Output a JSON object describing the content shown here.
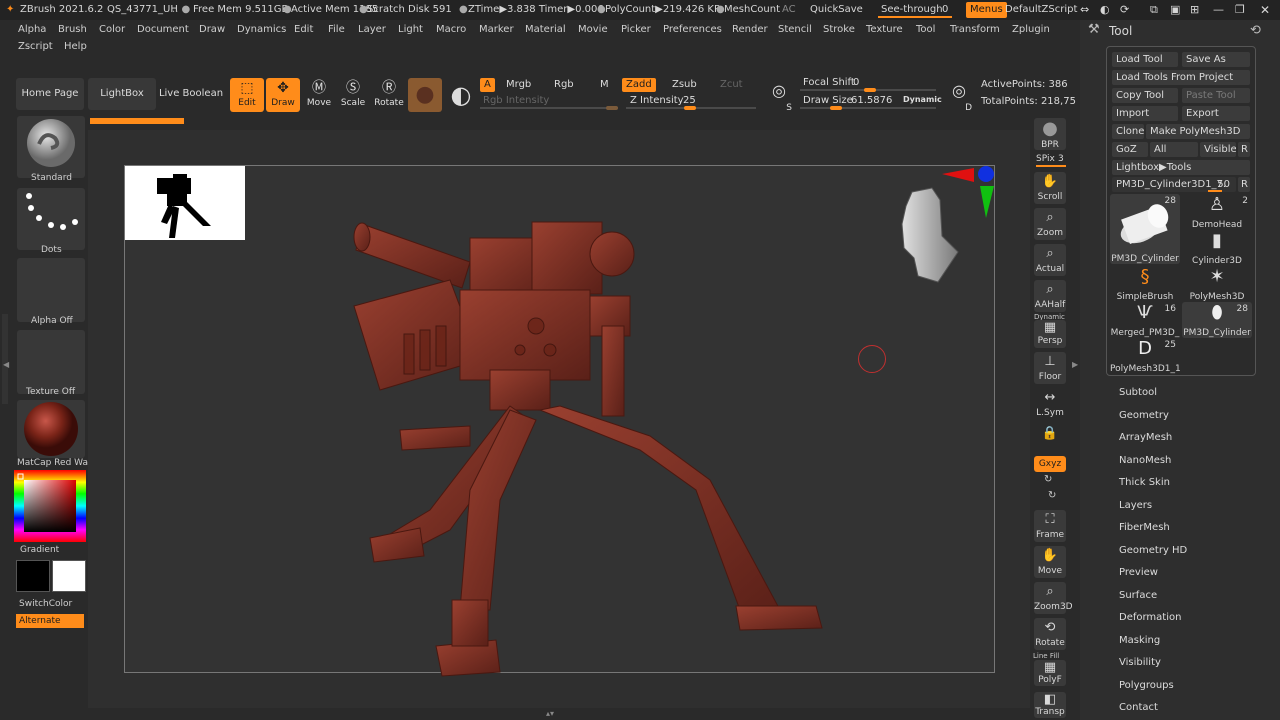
{
  "titlebar": {
    "app": "ZBrush 2021.6.2",
    "doc": "QS_43771_UH",
    "free_mem": "Free Mem 9.511GB",
    "active_mem": "Active Mem 1185",
    "scratch": "Scratch Disk 591",
    "ztime": "ZTime▶3.838 Timer▶0.006",
    "polycount": "PolyCount▶219.426 KP",
    "meshcount": "MeshCount",
    "ac": "AC",
    "quicksave": "QuickSave",
    "seethrough_label": "See-through",
    "seethrough_value": "0",
    "menus": "Menus",
    "zscript": "DefaultZScript"
  },
  "menu": {
    "row1": [
      "Alpha",
      "Brush",
      "Color",
      "Document",
      "Draw",
      "Dynamics",
      "Edit",
      "File",
      "Layer",
      "Light",
      "Macro",
      "Marker",
      "Material",
      "Movie",
      "Picker",
      "Preferences",
      "Render",
      "Stencil",
      "Stroke",
      "Texture",
      "Tool",
      "Transform",
      "Zplugin"
    ],
    "row2": [
      "Zscript",
      "Help"
    ]
  },
  "shelf": {
    "home": "Home Page",
    "lightbox": "LightBox",
    "live_boolean": "Live Boolean",
    "edit": "Edit",
    "draw": "Draw",
    "move": "Move",
    "scale": "Scale",
    "rotate": "Rotate",
    "a": "A",
    "mrgb": "Mrgb",
    "rgb": "Rgb",
    "m": "M",
    "zadd": "Zadd",
    "zsub": "Zsub",
    "zcut": "Zcut",
    "rgb_intensity": "Rgb Intensity",
    "z_intensity_label": "Z Intensity",
    "z_intensity_value": "25",
    "focal_label": "Focal Shift",
    "focal_value": "0",
    "drawsize_label": "Draw Size",
    "drawsize_value": "61.5876",
    "dynamic": "Dynamic",
    "active_points": "ActivePoints: 386",
    "total_points": "TotalPoints: 218,75"
  },
  "left": {
    "standard": "Standard",
    "dots": "Dots",
    "alpha_off": "Alpha Off",
    "texture_off": "Texture Off",
    "matcap": "MatCap Red Wa",
    "gradient": "Gradient",
    "switchcolor": "SwitchColor",
    "alternate": "Alternate"
  },
  "right_shelf": {
    "bpr": "BPR",
    "spix_label": "SPix",
    "spix_value": "3",
    "scroll": "Scroll",
    "zoom": "Zoom",
    "actual": "Actual",
    "aahalf": "AAHalf",
    "dynamic": "Dynamic",
    "persp": "Persp",
    "floor": "Floor",
    "lsym": "L.Sym",
    "xyz": "Gxyz",
    "frame": "Frame",
    "move": "Move",
    "zoom3d": "Zoom3D",
    "rotate": "Rotate",
    "line_fill": "Line Fill",
    "polyf": "PolyF",
    "transp": "Transp"
  },
  "tool_palette": {
    "title": "Tool",
    "load_tool": "Load Tool",
    "save_as": "Save As",
    "load_from_project": "Load Tools From Project",
    "copy_tool": "Copy Tool",
    "paste_tool": "Paste Tool",
    "import": "Import",
    "export": "Export",
    "clone": "Clone",
    "make_polymesh": "Make PolyMesh3D",
    "goz": "GoZ",
    "all": "All",
    "visible": "Visible",
    "r": "R",
    "lightbox_tools": "Lightbox▶Tools",
    "current_tool_label": "PM3D_Cylinder3D1_7.",
    "current_tool_value": "50",
    "thumbs": [
      {
        "label": "PM3D_Cylinder",
        "count": "28"
      },
      {
        "label": "DemoHead",
        "count": "2"
      },
      {
        "label": "Cylinder3D",
        "count": ""
      },
      {
        "label": "SimpleBrush",
        "count": ""
      },
      {
        "label": "PolyMesh3D",
        "count": ""
      },
      {
        "label": "Merged_PM3D_",
        "count": "16"
      },
      {
        "label": "PM3D_Cylinder",
        "count": "28"
      },
      {
        "label": "PolyMesh3D1_1",
        "count": "25"
      }
    ],
    "sections": [
      "Subtool",
      "Geometry",
      "ArrayMesh",
      "NanoMesh",
      "Thick Skin",
      "Layers",
      "FiberMesh",
      "Geometry HD",
      "Preview",
      "Surface",
      "Deformation",
      "Masking",
      "Visibility",
      "Polygroups",
      "Contact"
    ]
  },
  "colors": {
    "accent": "#ff8c1a",
    "model": "#7a3226",
    "panel": "#2a2a2a"
  }
}
